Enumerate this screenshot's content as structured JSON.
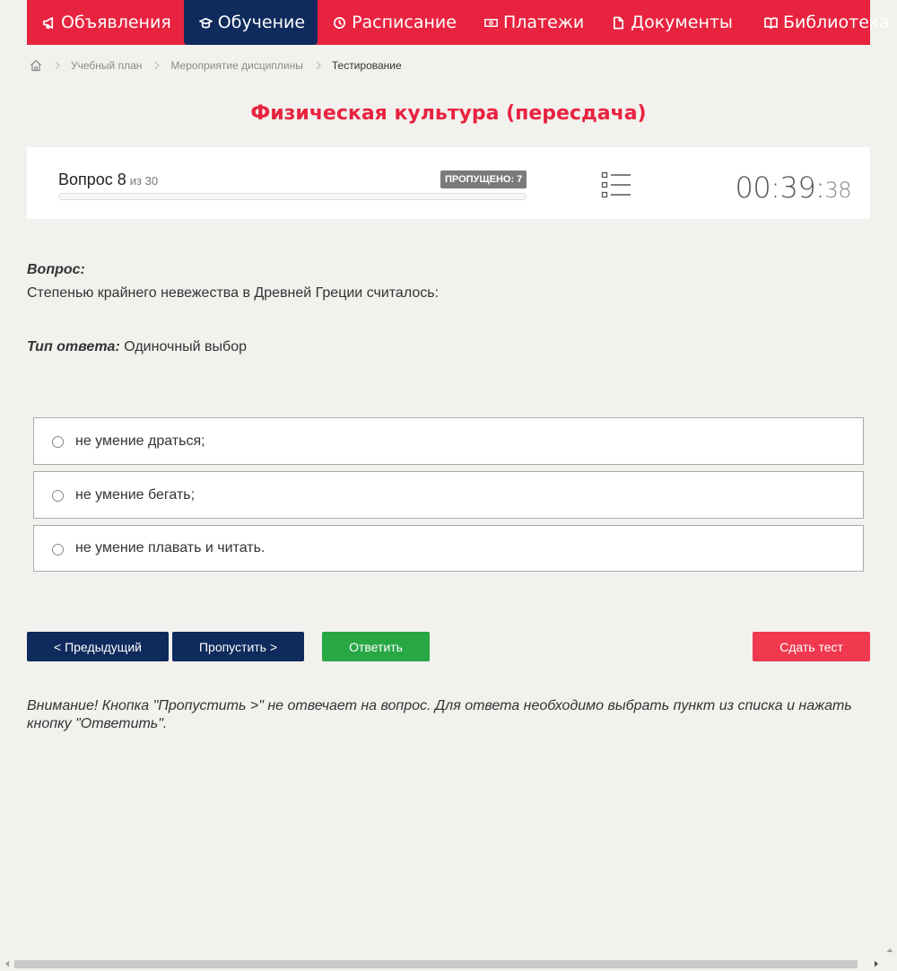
{
  "nav": {
    "items": [
      {
        "label": "Объявления",
        "icon": "megaphone-icon"
      },
      {
        "label": "Обучение",
        "icon": "graduation-cap-icon"
      },
      {
        "label": "Расписание",
        "icon": "clock-icon"
      },
      {
        "label": "Платежи",
        "icon": "money-icon"
      },
      {
        "label": "Документы",
        "icon": "document-icon"
      },
      {
        "label": "Библиотека",
        "icon": "book-icon"
      }
    ]
  },
  "breadcrumb": {
    "home_icon": "home-icon",
    "items": [
      "Учебный план",
      "Мероприятие дисциплины",
      "Тестирование"
    ]
  },
  "page_title": "Физическая культура (пересдача)",
  "progress": {
    "question_label": "Вопрос 8",
    "of_label": "из 30",
    "skipped_label": "ПРОПУЩЕНО: 7",
    "fraction": 0,
    "timer_main": "00:39:",
    "timer_seconds": "38"
  },
  "question": {
    "heading": "Вопрос:",
    "text": "Степенью крайнего невежества в Древней Греции считалось:",
    "answer_type_label": "Тип ответа:",
    "answer_type_value": "Одиночный выбор"
  },
  "options": [
    "не умение драться;",
    "не умение бегать;",
    "не умение плавать и читать."
  ],
  "buttons": {
    "prev": "< Предыдущий",
    "skip": "Пропустить >",
    "answer": "Ответить",
    "submit": "Сдать тест"
  },
  "warning": "Внимание! Кнопка \"Пропустить >\" не отвечает на вопрос. Для ответа необходимо выбрать пункт из списка и нажать кнопку \"Ответить\".",
  "colors": {
    "nav_bg": "#e8233f",
    "nav_active": "#0f2a5c",
    "title": "#e8233f",
    "answer_btn": "#28a745",
    "submit_btn": "#f0384f"
  }
}
